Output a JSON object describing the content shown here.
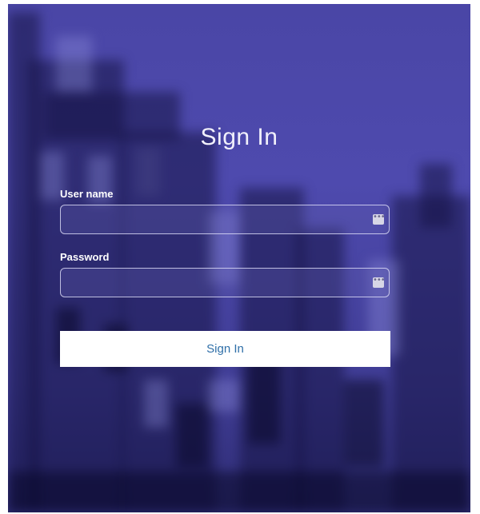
{
  "login": {
    "title": "Sign In",
    "username": {
      "label": "User name",
      "value": "",
      "placeholder": ""
    },
    "password": {
      "label": "Password",
      "value": "",
      "placeholder": ""
    },
    "submit_label": "Sign In",
    "field_icon": "more-dots-icon"
  },
  "colors": {
    "background_overlay": "#4a46a6",
    "button_background": "#ffffff",
    "button_text": "#2f6fa8",
    "text": "#ffffff"
  }
}
